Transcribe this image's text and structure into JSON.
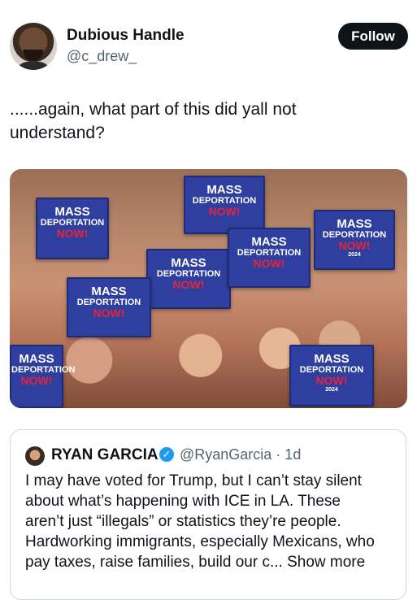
{
  "author": {
    "name": "Dubious Handle",
    "handle": "@c_drew_",
    "follow_label": "Follow"
  },
  "post": {
    "text_line1": "......again, what part of this did yall not",
    "text_line2": "understand?"
  },
  "media": {
    "signs": [
      {
        "line1": "MASS",
        "line2": "DEPORTATION",
        "line3": "NOW!",
        "year": ""
      },
      {
        "line1": "MASS",
        "line2": "DEPORTATION",
        "line3": "NOW!",
        "year": ""
      },
      {
        "line1": "MASS",
        "line2": "DEPORTATION",
        "line3": "NOW!",
        "year": ""
      },
      {
        "line1": "MASS",
        "line2": "DEPORTATION",
        "line3": "NOW!",
        "year": ""
      },
      {
        "line1": "MASS",
        "line2": "DEPORTATION",
        "line3": "NOW!",
        "year": "2024"
      },
      {
        "line1": "MASS",
        "line2": "DEPORTATION",
        "line3": "NOW!",
        "year": ""
      },
      {
        "line1": "MASS",
        "line2": "DEPORTATION",
        "line3": "NOW!",
        "year": ""
      },
      {
        "line1": "MASS",
        "line2": "DEPORTATION",
        "line3": "NOW!",
        "year": "2024"
      }
    ]
  },
  "quote": {
    "name": "RYAN GARCIA",
    "verified_icon": "verified-badge-icon",
    "handle_time": "@RyanGarcia · 1d",
    "line1": "I may have voted for Trump, but I can’t stay silent",
    "line2": "about what’s happening with ICE in LA. These",
    "line3": "aren’t just “illegals” or statistics they’re people.",
    "line4": "Hardworking immigrants, especially Mexicans, who",
    "line5": "pay taxes, raise families, build our c... Show more"
  }
}
